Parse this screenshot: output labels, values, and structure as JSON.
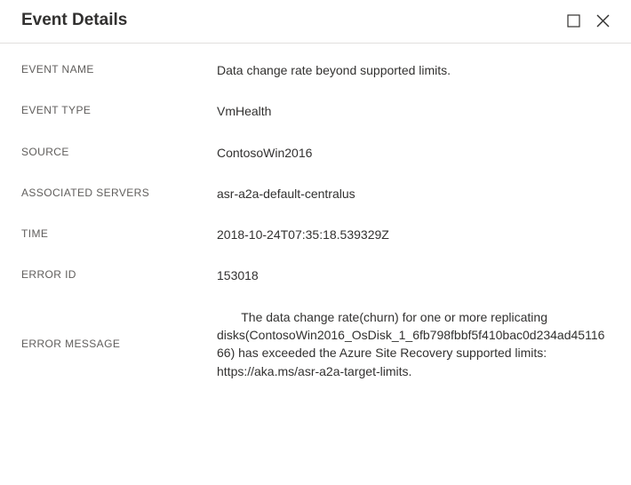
{
  "header": {
    "title": "Event Details"
  },
  "fields": {
    "event_name": {
      "label": "EVENT NAME",
      "value": "Data change rate beyond supported limits."
    },
    "event_type": {
      "label": "EVENT TYPE",
      "value": "VmHealth"
    },
    "source": {
      "label": "SOURCE",
      "value": "ContosoWin2016"
    },
    "associated_servers": {
      "label": "ASSOCIATED SERVERS",
      "value": "asr-a2a-default-centralus"
    },
    "time": {
      "label": "TIME",
      "value": "2018-10-24T07:35:18.539329Z"
    },
    "error_id": {
      "label": "ERROR ID",
      "value": "153018"
    },
    "error_message": {
      "label": "ERROR MESSAGE",
      "value": "       The data change rate(churn) for one or more replicating disks(ContosoWin2016_OsDisk_1_6fb798fbbf5f410bac0d234ad4511666) has exceeded the Azure Site Recovery supported limits: https://aka.ms/asr-a2a-target-limits."
    }
  }
}
